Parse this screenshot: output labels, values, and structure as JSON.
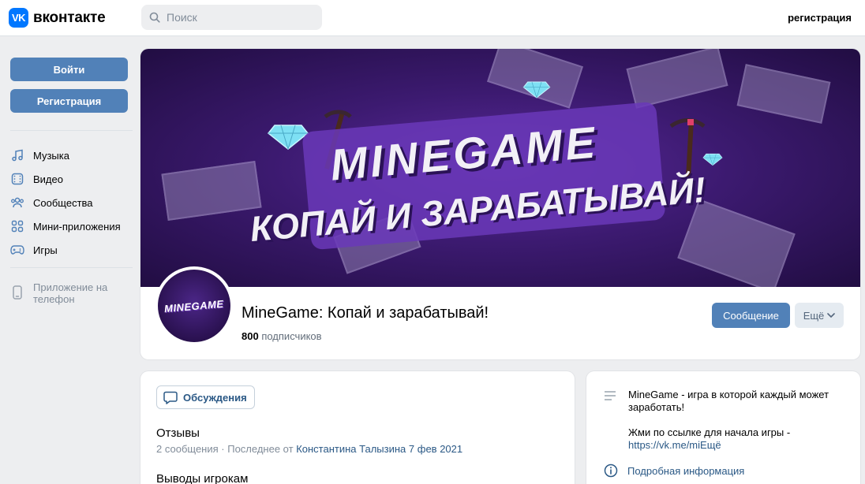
{
  "header": {
    "logo_mark": "VK",
    "logo_text": "вконтакте",
    "search_placeholder": "Поиск",
    "register_link": "регистрация"
  },
  "left": {
    "login_button": "Войти",
    "register_button": "Регистрация",
    "nav": [
      {
        "label": "Музыка",
        "icon": "music-icon"
      },
      {
        "label": "Видео",
        "icon": "video-icon"
      },
      {
        "label": "Сообщества",
        "icon": "communities-icon"
      },
      {
        "label": "Мини-приложения",
        "icon": "mini-apps-icon"
      },
      {
        "label": "Игры",
        "icon": "gamepad-icon"
      }
    ],
    "app_promo": "Приложение на телефон"
  },
  "group": {
    "cover_line1": "MINEGAME",
    "cover_line2": "КОПАЙ И ЗАРАБАТЫВАЙ!",
    "avatar_text": "MINEGAME",
    "title": "MineGame: Копай и зарабатывай!",
    "subscribers_count": "800",
    "subscribers_label": "подписчиков",
    "message_button": "Сообщение",
    "more_button": "Ещё"
  },
  "discussions": {
    "tab_label": "Обсуждения",
    "topics": [
      {
        "title": "Отзывы",
        "count": "2 сообщения",
        "sep": "· Последнее от",
        "author": "Константина Талызина",
        "date": "7 фев 2021"
      },
      {
        "title": "Выводы игрокам"
      }
    ]
  },
  "info": {
    "desc_line1": "MineGame - игра в которой каждый может заработать!",
    "desc_line2": "Жми по ссылке для начала игры -",
    "link": "https://vk.me/mi",
    "link_more": "Ещё",
    "details": "Подробная информация"
  },
  "colors": {
    "accent": "#5181b8",
    "brand": "#0077ff",
    "link": "#2a5885",
    "cover": "#3c1a70"
  }
}
